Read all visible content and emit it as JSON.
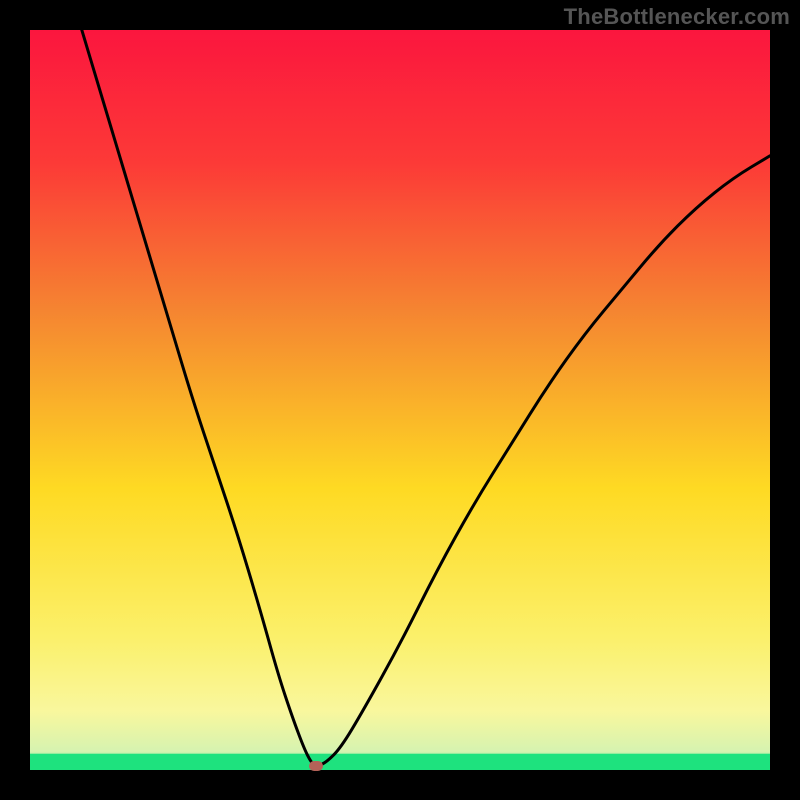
{
  "watermark": "TheBottlenecker.com",
  "colors": {
    "gradient_top": "#fb163e",
    "gradient_mid1": "#f58531",
    "gradient_mid2": "#feda23",
    "gradient_mid3": "#f9f79d",
    "gradient_bottom": "#1ee27e",
    "curve": "#000000",
    "frame": "#000000",
    "marker": "#b46258"
  },
  "chart_data": {
    "type": "line",
    "title": "",
    "xlabel": "",
    "ylabel": "",
    "xlim": [
      0,
      100
    ],
    "ylim": [
      0,
      100
    ],
    "series": [
      {
        "name": "bottleneck-curve",
        "x": [
          7,
          10,
          13,
          16,
          19,
          22,
          25,
          28,
          31,
          33.5,
          35.5,
          37,
          38,
          38.7,
          40,
          42,
          45,
          50,
          55,
          60,
          65,
          70,
          75,
          80,
          85,
          90,
          95,
          100
        ],
        "y": [
          100,
          90,
          80,
          70,
          60,
          50,
          41,
          32,
          22,
          13,
          7,
          3,
          1,
          0.5,
          1,
          3,
          8,
          17,
          27,
          36,
          44,
          52,
          59,
          65,
          71,
          76,
          80,
          83
        ]
      }
    ],
    "marker": {
      "x": 38.7,
      "y": 0.5
    },
    "green_band_y": 2.2
  }
}
